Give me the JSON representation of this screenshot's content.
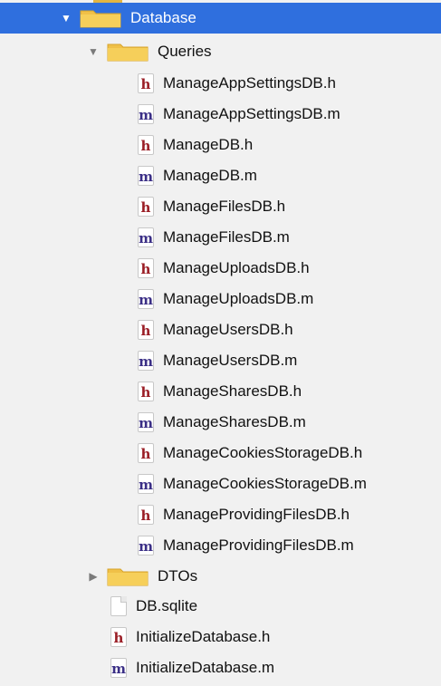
{
  "colors": {
    "selection": "#2f6fde",
    "header_file": "#9a1d25",
    "implementation_file": "#3b2f86",
    "folder": "#f0c048"
  },
  "tree": {
    "database": {
      "label": "Database",
      "icon": "folder-icon",
      "state": "expanded",
      "selected": true
    },
    "queries": {
      "label": "Queries",
      "icon": "folder-icon",
      "state": "expanded",
      "files": [
        {
          "label": "ManageAppSettingsDB.h",
          "type": "h",
          "icon": "header-file-icon"
        },
        {
          "label": "ManageAppSettingsDB.m",
          "type": "m",
          "icon": "objc-file-icon"
        },
        {
          "label": "ManageDB.h",
          "type": "h",
          "icon": "header-file-icon"
        },
        {
          "label": "ManageDB.m",
          "type": "m",
          "icon": "objc-file-icon"
        },
        {
          "label": "ManageFilesDB.h",
          "type": "h",
          "icon": "header-file-icon"
        },
        {
          "label": "ManageFilesDB.m",
          "type": "m",
          "icon": "objc-file-icon"
        },
        {
          "label": "ManageUploadsDB.h",
          "type": "h",
          "icon": "header-file-icon"
        },
        {
          "label": "ManageUploadsDB.m",
          "type": "m",
          "icon": "objc-file-icon"
        },
        {
          "label": "ManageUsersDB.h",
          "type": "h",
          "icon": "header-file-icon"
        },
        {
          "label": "ManageUsersDB.m",
          "type": "m",
          "icon": "objc-file-icon"
        },
        {
          "label": "ManageSharesDB.h",
          "type": "h",
          "icon": "header-file-icon"
        },
        {
          "label": "ManageSharesDB.m",
          "type": "m",
          "icon": "objc-file-icon"
        },
        {
          "label": "ManageCookiesStorageDB.h",
          "type": "h",
          "icon": "header-file-icon"
        },
        {
          "label": "ManageCookiesStorageDB.m",
          "type": "m",
          "icon": "objc-file-icon"
        },
        {
          "label": "ManageProvidingFilesDB.h",
          "type": "h",
          "icon": "header-file-icon"
        },
        {
          "label": "ManageProvidingFilesDB.m",
          "type": "m",
          "icon": "objc-file-icon"
        }
      ]
    },
    "dtos": {
      "label": "DTOs",
      "icon": "folder-icon",
      "state": "collapsed"
    },
    "files": [
      {
        "label": "DB.sqlite",
        "type": "blank",
        "icon": "document-icon"
      },
      {
        "label": "InitializeDatabase.h",
        "type": "h",
        "icon": "header-file-icon"
      },
      {
        "label": "InitializeDatabase.m",
        "type": "m",
        "icon": "objc-file-icon"
      }
    ]
  }
}
